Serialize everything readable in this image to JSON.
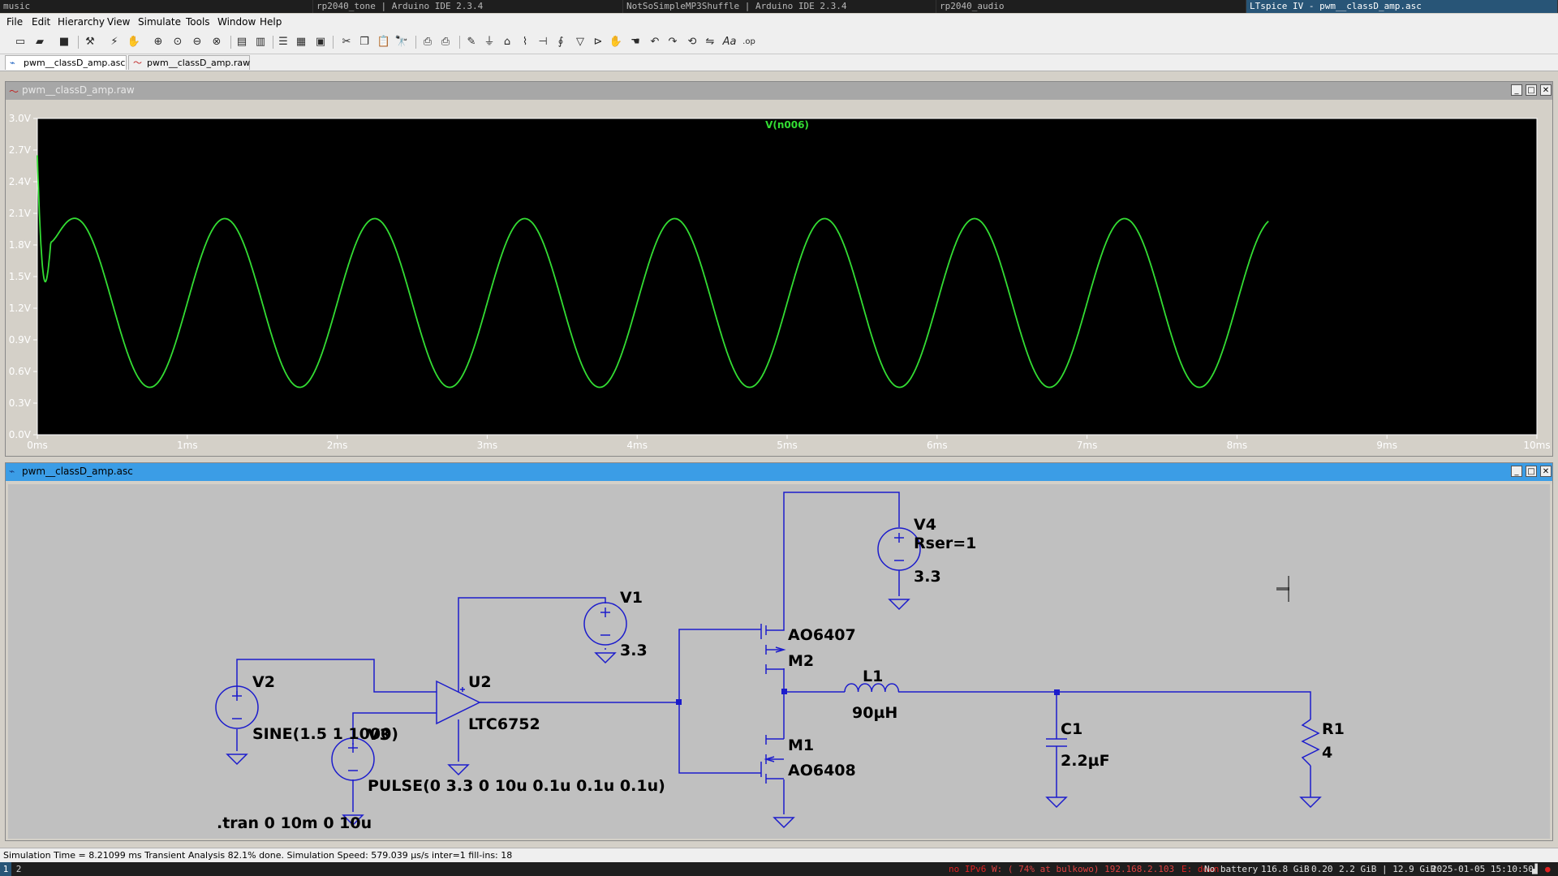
{
  "wm": {
    "tabs": [
      "music",
      "rp2040_tone | Arduino IDE 2.3.4",
      "NotSoSimpleMP3Shuffle | Arduino IDE 2.3.4",
      "rp2040_audio",
      "LTspice IV - pwm__classD_amp.asc"
    ]
  },
  "menu": [
    "File",
    "Edit",
    "Hierarchy",
    "View",
    "Simulate",
    "Tools",
    "Window",
    "Help"
  ],
  "toolbar_icons": [
    "new-schematic-icon",
    "open-icon",
    "save-icon",
    "control-panel-icon",
    "run-icon",
    "halt-icon",
    "zoom-in-icon",
    "zoom-pan-icon",
    "zoom-out-icon",
    "zoom-fit-icon",
    "autorange-icon",
    "cancel-icon",
    "tile-horizontal-icon",
    "tile-vertical-icon",
    "cascade-icon",
    "cut-icon",
    "copy-icon",
    "paste-icon",
    "find-icon",
    "print-setup-icon",
    "print-icon",
    "wire-icon",
    "ground-icon",
    "label-icon",
    "resistor-icon",
    "capacitor-icon",
    "inductor-icon",
    "diode-icon",
    "component-icon",
    "move-icon",
    "drag-icon",
    "undo-icon",
    "redo-icon",
    "rotate-icon",
    "mirror-icon",
    "text-icon",
    "spice-directive-icon"
  ],
  "doc_tabs": [
    "pwm__classD_amp.asc",
    "pwm__classD_amp.raw"
  ],
  "waveform": {
    "window_title": "pwm__classD_amp.raw",
    "trace_label": "V(n006)",
    "trace_color": "#33dd33",
    "y_ticks": [
      "3.0V",
      "2.7V",
      "2.4V",
      "2.1V",
      "1.8V",
      "1.5V",
      "1.2V",
      "0.9V",
      "0.6V",
      "0.3V",
      "0.0V"
    ],
    "x_ticks": [
      "0ms",
      "1ms",
      "2ms",
      "3ms",
      "4ms",
      "5ms",
      "6ms",
      "7ms",
      "8ms",
      "9ms",
      "10ms"
    ]
  },
  "chart_data": {
    "type": "line",
    "series": [
      {
        "name": "V(n006)",
        "x_end_ms": 8.21,
        "offset_v": 1.25,
        "amplitude_v": 0.8,
        "frequency_hz": 1000,
        "initial_v": 2.65
      }
    ],
    "xlim": [
      0,
      10
    ],
    "ylim": [
      0,
      3.0
    ],
    "xlabel": "",
    "ylabel": "",
    "grid": false
  },
  "schematic": {
    "window_title": "pwm__classD_amp.asc",
    "labels": {
      "v4": "V4",
      "v4_rser": "Rser=1",
      "v4_val": "3.3",
      "v1": "V1",
      "v1_val": "3.3",
      "v2": "V2",
      "v2_val": "SINE(1.5 1 1000)",
      "v3": "V3",
      "v3_val": "PULSE(0 3.3 0 10u 0.1u 0.1u 0.1u)",
      "u2": "U2",
      "u2_part": "LTC6752",
      "m2_part": "AO6407",
      "m2": "M2",
      "m1": "M1",
      "m1_part": "AO6408",
      "l1": "L1",
      "l1_val": "90µH",
      "c1": "C1",
      "c1_val": "2.2µF",
      "r1": "R1",
      "r1_val": "4",
      "tran": ".tran 0 10m 0 10u"
    }
  },
  "status": "Simulation Time = 8.21099 ms  Transient Analysis 82.1% done. Simulation Speed: 579.039 µs/s inter=1 fill-ins: 18",
  "taskbar": {
    "workspaces": [
      "1",
      "2"
    ],
    "ipv6": "no IPv6",
    "wifi": "W: ( 74% at bulkowo) 192.168.2.103",
    "ethernet": "E: down",
    "battery": "No battery",
    "disk": "116.8 GiB",
    "load": "0.20",
    "mem": "2.2 GiB | 12.9 GiB",
    "datetime": "2025-01-05 15:10:50"
  }
}
